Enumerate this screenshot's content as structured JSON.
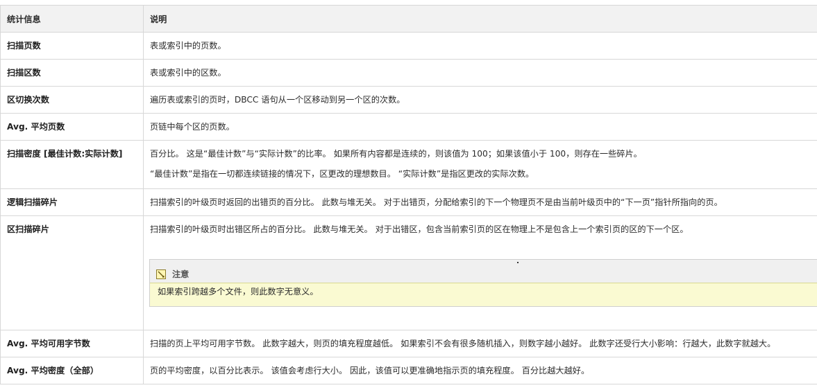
{
  "header": {
    "col1": "统计信息",
    "col2": "说明"
  },
  "rows": [
    {
      "stat": "扫描页数",
      "desc": [
        "表或索引中的页数。"
      ]
    },
    {
      "stat": "扫描区数",
      "desc": [
        "表或索引中的区数。"
      ]
    },
    {
      "stat": "区切换次数",
      "desc": [
        "遍历表或索引的页时，DBCC 语句从一个区移动到另一个区的次数。"
      ]
    },
    {
      "stat": "Avg. 平均页数",
      "desc": [
        "页链中每个区的页数。"
      ]
    },
    {
      "stat": "扫描密度 [最佳计数:实际计数]",
      "desc": [
        "百分比。 这是“最佳计数”与“实际计数”的比率。 如果所有内容都是连续的，则该值为 100；如果该值小于 100，则存在一些碎片。",
        "“最佳计数”是指在一切都连续链接的情况下，区更改的理想数目。 “实际计数”是指区更改的实际次数。"
      ]
    },
    {
      "stat": "逻辑扫描碎片",
      "desc": [
        "扫描索引的叶级页时返回的出错页的百分比。 此数与堆无关。 对于出错页，分配给索引的下一个物理页不是由当前叶级页中的“下一页”指针所指向的页。"
      ]
    },
    {
      "stat": "区扫描碎片",
      "desc": [
        "扫描索引的叶级页时出错区所占的百分比。 此数与堆无关。 对于出错区，包含当前索引页的区在物理上不是包含上一个索引页的区的下一个区。"
      ],
      "note": {
        "title": "注意",
        "text": "如果索引跨越多个文件，则此数字无意义。",
        "icon": "note-icon"
      }
    },
    {
      "stat": "Avg. 平均可用字节数",
      "desc": [
        "扫描的页上平均可用字节数。 此数字越大，则页的填充程度越低。 如果索引不会有很多随机插入，则数字越小越好。 此数字还受行大小影响：行越大，此数字就越大。"
      ]
    },
    {
      "stat": "Avg. 平均密度（全部）",
      "desc": [
        "页的平均密度，以百分比表示。 该值会考虑行大小。 因此，该值可以更准确地指示页的填充程度。 百分比越大越好。"
      ]
    }
  ]
}
